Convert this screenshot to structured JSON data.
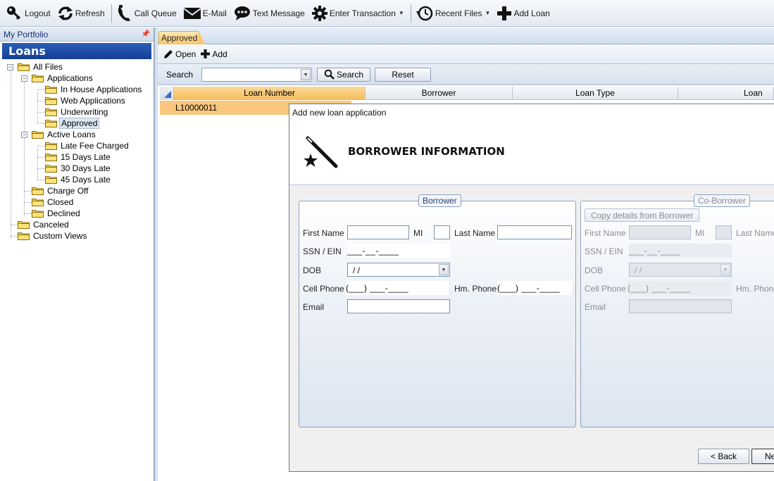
{
  "toolbar": {
    "logout": "Logout",
    "refresh": "Refresh",
    "call_queue": "Call Queue",
    "email": "E-Mail",
    "text_message": "Text Message",
    "enter_transaction": "Enter Transaction",
    "recent_files": "Recent Files",
    "add_loan": "Add Loan"
  },
  "sidebar": {
    "header": "My Portfolio",
    "title": "Loans",
    "tree": {
      "all_files": "All Files",
      "applications": "Applications",
      "in_house": "In House Applications",
      "web_applications": "Web Applications",
      "underwriting": "Underwriting",
      "approved": "Approved",
      "active_loans": "Active Loans",
      "late_fee": "Late Fee Charged",
      "days15": "15 Days Late",
      "days30": "30 Days Late",
      "days45": "45 Days Late",
      "charge_off": "Charge Off",
      "closed": "Closed",
      "declined": "Declined",
      "canceled": "Canceled",
      "custom_views": "Custom Views"
    }
  },
  "main": {
    "tab": "Approved",
    "actions": {
      "open": "Open",
      "add": "Add"
    },
    "search": {
      "label": "Search",
      "button": "Search",
      "reset": "Reset",
      "value": ""
    },
    "grid": {
      "columns": [
        "Loan Number",
        "Borrower",
        "Loan Type",
        "Loan Am"
      ],
      "rows": [
        [
          "L10000011"
        ]
      ]
    }
  },
  "dialog": {
    "title": "Add new loan application",
    "heading": "BORROWER INFORMATION",
    "borrower": {
      "legend": "Borrower",
      "first_name": "First Name",
      "mi": "MI",
      "last_name": "Last Name",
      "ssn": "SSN / EIN",
      "ssn_mask": "___-__-____",
      "dob": "DOB",
      "dob_mask": " /  /",
      "cell_phone": "Cell Phone",
      "cell_mask": "(___) ___-____",
      "hm_phone": "Hm. Phone",
      "hm_mask": "(___) ___-____",
      "email": "Email"
    },
    "coborrower": {
      "legend": "Co-Borrower",
      "copy_button": "Copy details from Borrower",
      "first_name": "First Name",
      "mi": "MI",
      "last_name": "Last Name",
      "ssn": "SSN / EIN",
      "ssn_mask": "___-__-____",
      "dob": "DOB",
      "dob_mask": " /  /",
      "cell_phone": "Cell Phone",
      "cell_mask": "(___) ___-____",
      "hm_phone": "Hm. Phone",
      "email": "Email"
    },
    "back": "< Back",
    "next": "Ne"
  },
  "colors": {
    "accent_blue": "#153e93",
    "selection_orange": "#f9c77d",
    "tab_orange": "#f7c66a"
  }
}
